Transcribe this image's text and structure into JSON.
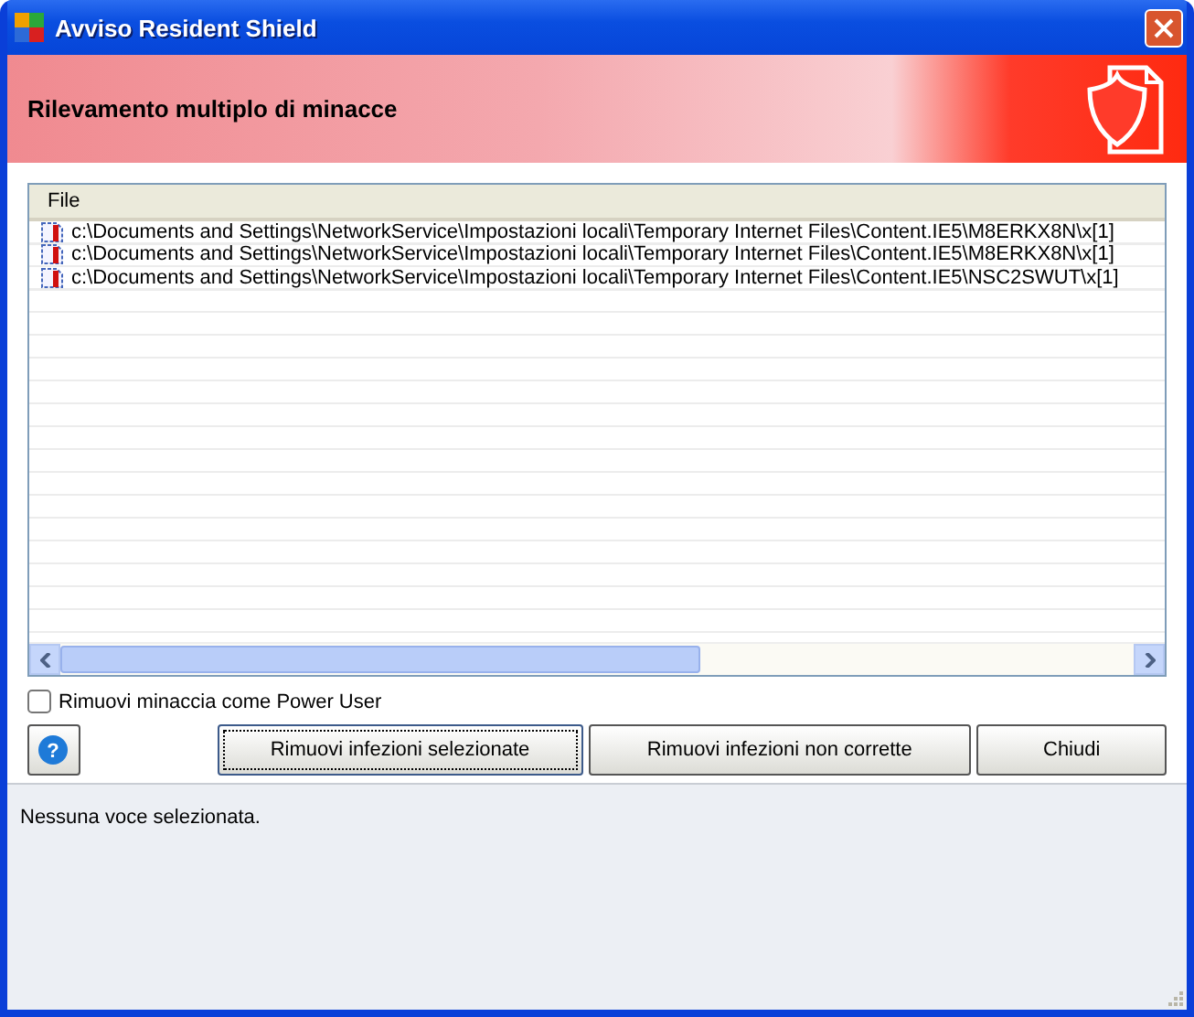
{
  "window": {
    "title": "Avviso Resident Shield"
  },
  "header": {
    "title": "Rilevamento multiplo di minacce"
  },
  "table": {
    "columns": [
      "File"
    ],
    "rows": [
      {
        "path": "c:\\Documents and Settings\\NetworkService\\Impostazioni locali\\Temporary Internet Files\\Content.IE5\\M8ERKX8N\\x[1]"
      },
      {
        "path": "c:\\Documents and Settings\\NetworkService\\Impostazioni locali\\Temporary Internet Files\\Content.IE5\\M8ERKX8N\\x[1]"
      },
      {
        "path": "c:\\Documents and Settings\\NetworkService\\Impostazioni locali\\Temporary Internet Files\\Content.IE5\\NSC2SWUT\\x[1]"
      }
    ]
  },
  "power_user": {
    "label": "Rimuovi minaccia come Power User",
    "checked": false
  },
  "buttons": [
    {
      "label": "Rimuovi infezioni selezionate",
      "focused": true
    },
    {
      "label": "Rimuovi infezioni non corrette",
      "focused": false
    },
    {
      "label": "Chiudi",
      "focused": false
    }
  ],
  "help_button": "?",
  "status": "Nessuna voce selezionata."
}
